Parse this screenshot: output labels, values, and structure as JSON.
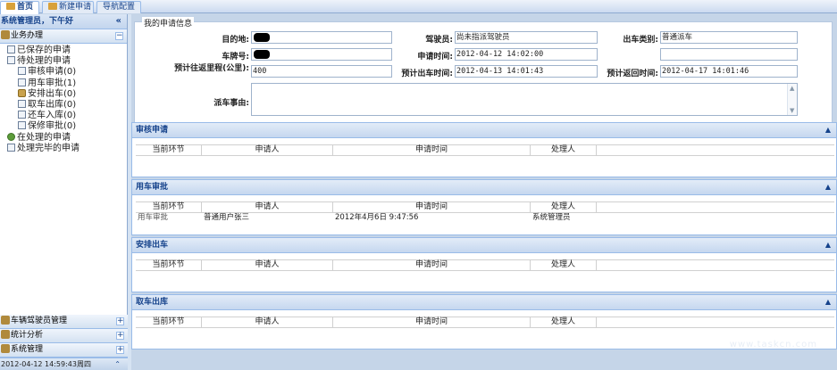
{
  "tabs": [
    {
      "label": "首页"
    },
    {
      "label": "新建申请"
    },
    {
      "label": "导航配置"
    }
  ],
  "sidebar": {
    "greeting": "系统管理员，下午好",
    "collapse_glyph": "«",
    "section_title": "业务办理",
    "tree": [
      {
        "label": "已保存的申请"
      },
      {
        "label": "待处理的申请"
      },
      {
        "label": "审核申请(0)"
      },
      {
        "label": "用车审批(1)"
      },
      {
        "label": "安排出车(0)"
      },
      {
        "label": "取车出库(0)"
      },
      {
        "label": "还车入库(0)"
      },
      {
        "label": "保修审批(0)"
      },
      {
        "label": "在处理的申请"
      },
      {
        "label": "处理完毕的申请"
      }
    ],
    "bottom_sections": [
      {
        "label": "车辆驾驶员管理"
      },
      {
        "label": "统计分析"
      },
      {
        "label": "系统管理"
      }
    ],
    "status_time": "2012-04-12 14:59:43周四"
  },
  "form": {
    "legend": "我的申请信息",
    "fields": {
      "destination": {
        "label": "目的地:",
        "value": ""
      },
      "driver": {
        "label": "驾驶员:",
        "value": "尚未指派驾驶员"
      },
      "dispatch_type": {
        "label": "出车类别:",
        "value": "普通派车"
      },
      "plate": {
        "label": "车牌号:",
        "value": ""
      },
      "apply_time": {
        "label": "申请时间:",
        "value": "2012-04-12 14:02:00"
      },
      "est_mileage": {
        "label": "预计往返里程(公里):",
        "value": "400"
      },
      "est_depart": {
        "label": "预计出车时间:",
        "value": "2012-04-13 14:01:43"
      },
      "est_return": {
        "label": "预计返回时间:",
        "value": "2012-04-17 14:01:46"
      },
      "reason": {
        "label": "派车事由:",
        "value": ""
      }
    }
  },
  "grid_headers": [
    "当前环节",
    "申请人",
    "申请时间",
    "处理人"
  ],
  "panels": [
    {
      "title": "审核申请",
      "rows": []
    },
    {
      "title": "用车审批",
      "rows": [
        [
          "用车审批",
          "普通用户张三",
          "2012年4月6日  9:47:56",
          "系统管理员"
        ]
      ]
    },
    {
      "title": "安排出车",
      "rows": []
    },
    {
      "title": "取车出库",
      "rows": []
    }
  ],
  "watermark": "www.taskcn.com"
}
